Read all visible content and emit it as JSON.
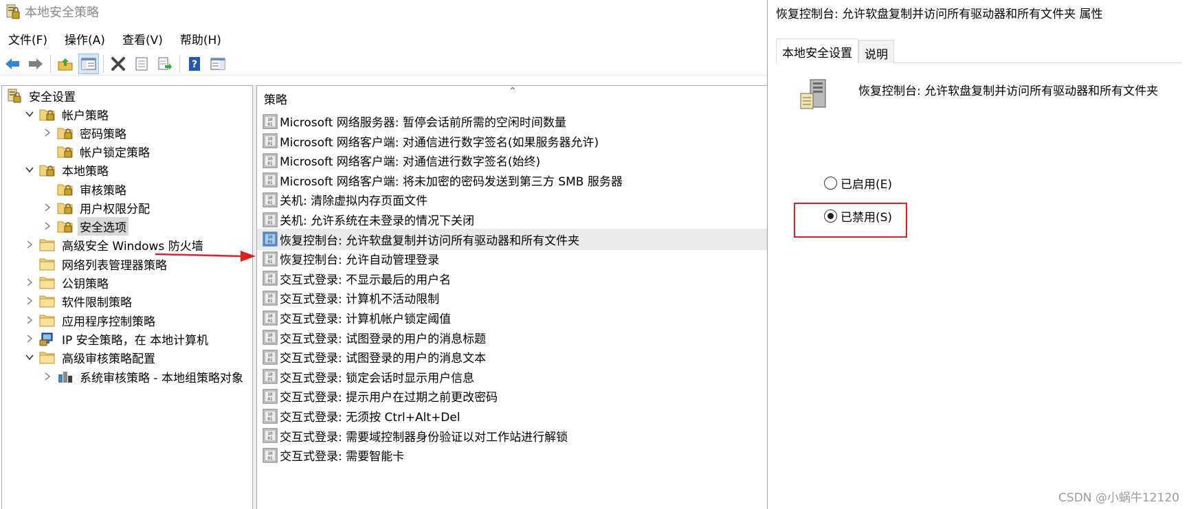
{
  "window": {
    "title": "本地安全策略"
  },
  "menu": [
    {
      "label": "文件(F)"
    },
    {
      "label": "操作(A)"
    },
    {
      "label": "查看(V)"
    },
    {
      "label": "帮助(H)"
    }
  ],
  "toolbar": [
    "back-icon",
    "forward-icon",
    "up-folder-icon",
    "show-hide-tree-icon",
    "delete-icon",
    "properties-icon",
    "export-list-icon",
    "help-icon",
    "show-action-pane-icon"
  ],
  "tree": [
    {
      "label": "安全设置",
      "level": 0,
      "expander": "",
      "icon": "security-settings-icon"
    },
    {
      "label": "帐户策略",
      "level": 1,
      "expander": "expanded",
      "icon": "folder-lock-icon"
    },
    {
      "label": "密码策略",
      "level": 2,
      "expander": "collapsed",
      "icon": "folder-lock-icon"
    },
    {
      "label": "帐户锁定策略",
      "level": 2,
      "expander": "",
      "icon": "folder-lock-icon"
    },
    {
      "label": "本地策略",
      "level": 1,
      "expander": "expanded",
      "icon": "folder-lock-icon"
    },
    {
      "label": "审核策略",
      "level": 2,
      "expander": "",
      "icon": "folder-lock-icon"
    },
    {
      "label": "用户权限分配",
      "level": 2,
      "expander": "collapsed",
      "icon": "folder-lock-icon"
    },
    {
      "label": "安全选项",
      "level": 2,
      "expander": "collapsed",
      "icon": "folder-lock-icon",
      "selected": true
    },
    {
      "label": "高级安全 Windows 防火墙",
      "level": 1,
      "expander": "collapsed",
      "icon": "folder-icon"
    },
    {
      "label": "网络列表管理器策略",
      "level": 1,
      "expander": "",
      "icon": "folder-icon"
    },
    {
      "label": "公钥策略",
      "level": 1,
      "expander": "collapsed",
      "icon": "folder-icon"
    },
    {
      "label": "软件限制策略",
      "level": 1,
      "expander": "collapsed",
      "icon": "folder-icon"
    },
    {
      "label": "应用程序控制策略",
      "level": 1,
      "expander": "collapsed",
      "icon": "folder-icon"
    },
    {
      "label": "IP 安全策略，在 本地计算机",
      "level": 1,
      "expander": "collapsed",
      "icon": "ip-security-icon"
    },
    {
      "label": "高级审核策略配置",
      "level": 1,
      "expander": "expanded",
      "icon": "folder-icon"
    },
    {
      "label": "系统审核策略 - 本地组策略对象",
      "level": 2,
      "expander": "collapsed",
      "icon": "audit-policy-icon"
    }
  ],
  "list": {
    "column_header": "策略",
    "rows": [
      {
        "label": "Microsoft 网络服务器: 暂停会话前所需的空闲时间数量"
      },
      {
        "label": "Microsoft 网络客户端: 对通信进行数字签名(如果服务器允许)"
      },
      {
        "label": "Microsoft 网络客户端: 对通信进行数字签名(始终)"
      },
      {
        "label": "Microsoft 网络客户端: 将未加密的密码发送到第三方 SMB 服务器"
      },
      {
        "label": "关机: 清除虚拟内存页面文件"
      },
      {
        "label": "关机: 允许系统在未登录的情况下关闭"
      },
      {
        "label": "恢复控制台: 允许软盘复制并访问所有驱动器和所有文件夹",
        "selected": true
      },
      {
        "label": "恢复控制台: 允许自动管理登录"
      },
      {
        "label": "交互式登录: 不显示最后的用户名"
      },
      {
        "label": "交互式登录: 计算机不活动限制"
      },
      {
        "label": "交互式登录: 计算机帐户锁定阈值"
      },
      {
        "label": "交互式登录: 试图登录的用户的消息标题"
      },
      {
        "label": "交互式登录: 试图登录的用户的消息文本"
      },
      {
        "label": "交互式登录: 锁定会话时显示用户信息"
      },
      {
        "label": "交互式登录: 提示用户在过期之前更改密码"
      },
      {
        "label": "交互式登录: 无须按 Ctrl+Alt+Del"
      },
      {
        "label": "交互式登录: 需要域控制器身份验证以对工作站进行解锁"
      },
      {
        "label": "交互式登录: 需要智能卡"
      }
    ]
  },
  "dialog": {
    "title": "恢复控制台: 允许软盘复制并访问所有驱动器和所有文件夹 属性",
    "tabs": [
      {
        "label": "本地安全设置",
        "active": true
      },
      {
        "label": "说明",
        "active": false
      }
    ],
    "policy_name": "恢复控制台: 允许软盘复制并访问所有驱动器和所有文件夹",
    "options": [
      {
        "label": "已启用(E)",
        "checked": false
      },
      {
        "label": "已禁用(S)",
        "checked": true
      }
    ]
  },
  "watermark": "CSDN @小蜗牛12120",
  "colors": {
    "annotation_red": "#e02020",
    "selected_row": "#eaeaea",
    "selected_tree": "#d9d9d9"
  }
}
